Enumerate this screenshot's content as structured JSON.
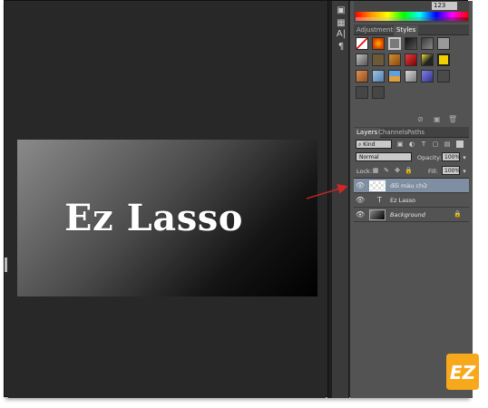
{
  "canvas": {
    "text": "Ez Lasso"
  },
  "colors": {
    "accent_arrow": "#d22626",
    "logo_orange": "#f7a81b",
    "panel_bg": "#535353",
    "workspace_bg": "#282828",
    "active_layer": "#7f8fa1"
  },
  "toolstrip": {
    "icons": [
      "color-picker-icon",
      "swatch-panel-icon",
      "character-panel-icon",
      "paragraph-panel-icon"
    ]
  },
  "color_panel": {
    "value": "123"
  },
  "adjustments": {
    "tabs": [
      {
        "label": "Adjustments",
        "active": false
      },
      {
        "label": "Styles",
        "active": true
      }
    ]
  },
  "layers": {
    "tabs": [
      {
        "label": "Layers",
        "active": true
      },
      {
        "label": "Channels",
        "active": false
      },
      {
        "label": "Paths",
        "active": false
      }
    ],
    "filter": "Kind",
    "blend_mode": "Normal",
    "opacity_label": "Opacity:",
    "opacity_value": "100%",
    "lock_label": "Lock:",
    "fill_label": "Fill:",
    "fill_value": "100%",
    "items": [
      {
        "name": "đổi màu chữ",
        "type": "pixel",
        "active": true
      },
      {
        "name": "Ez Lasso",
        "type": "text",
        "active": false
      },
      {
        "name": "Background",
        "type": "background",
        "active": false
      }
    ]
  },
  "logo": {
    "text": "EZ"
  }
}
